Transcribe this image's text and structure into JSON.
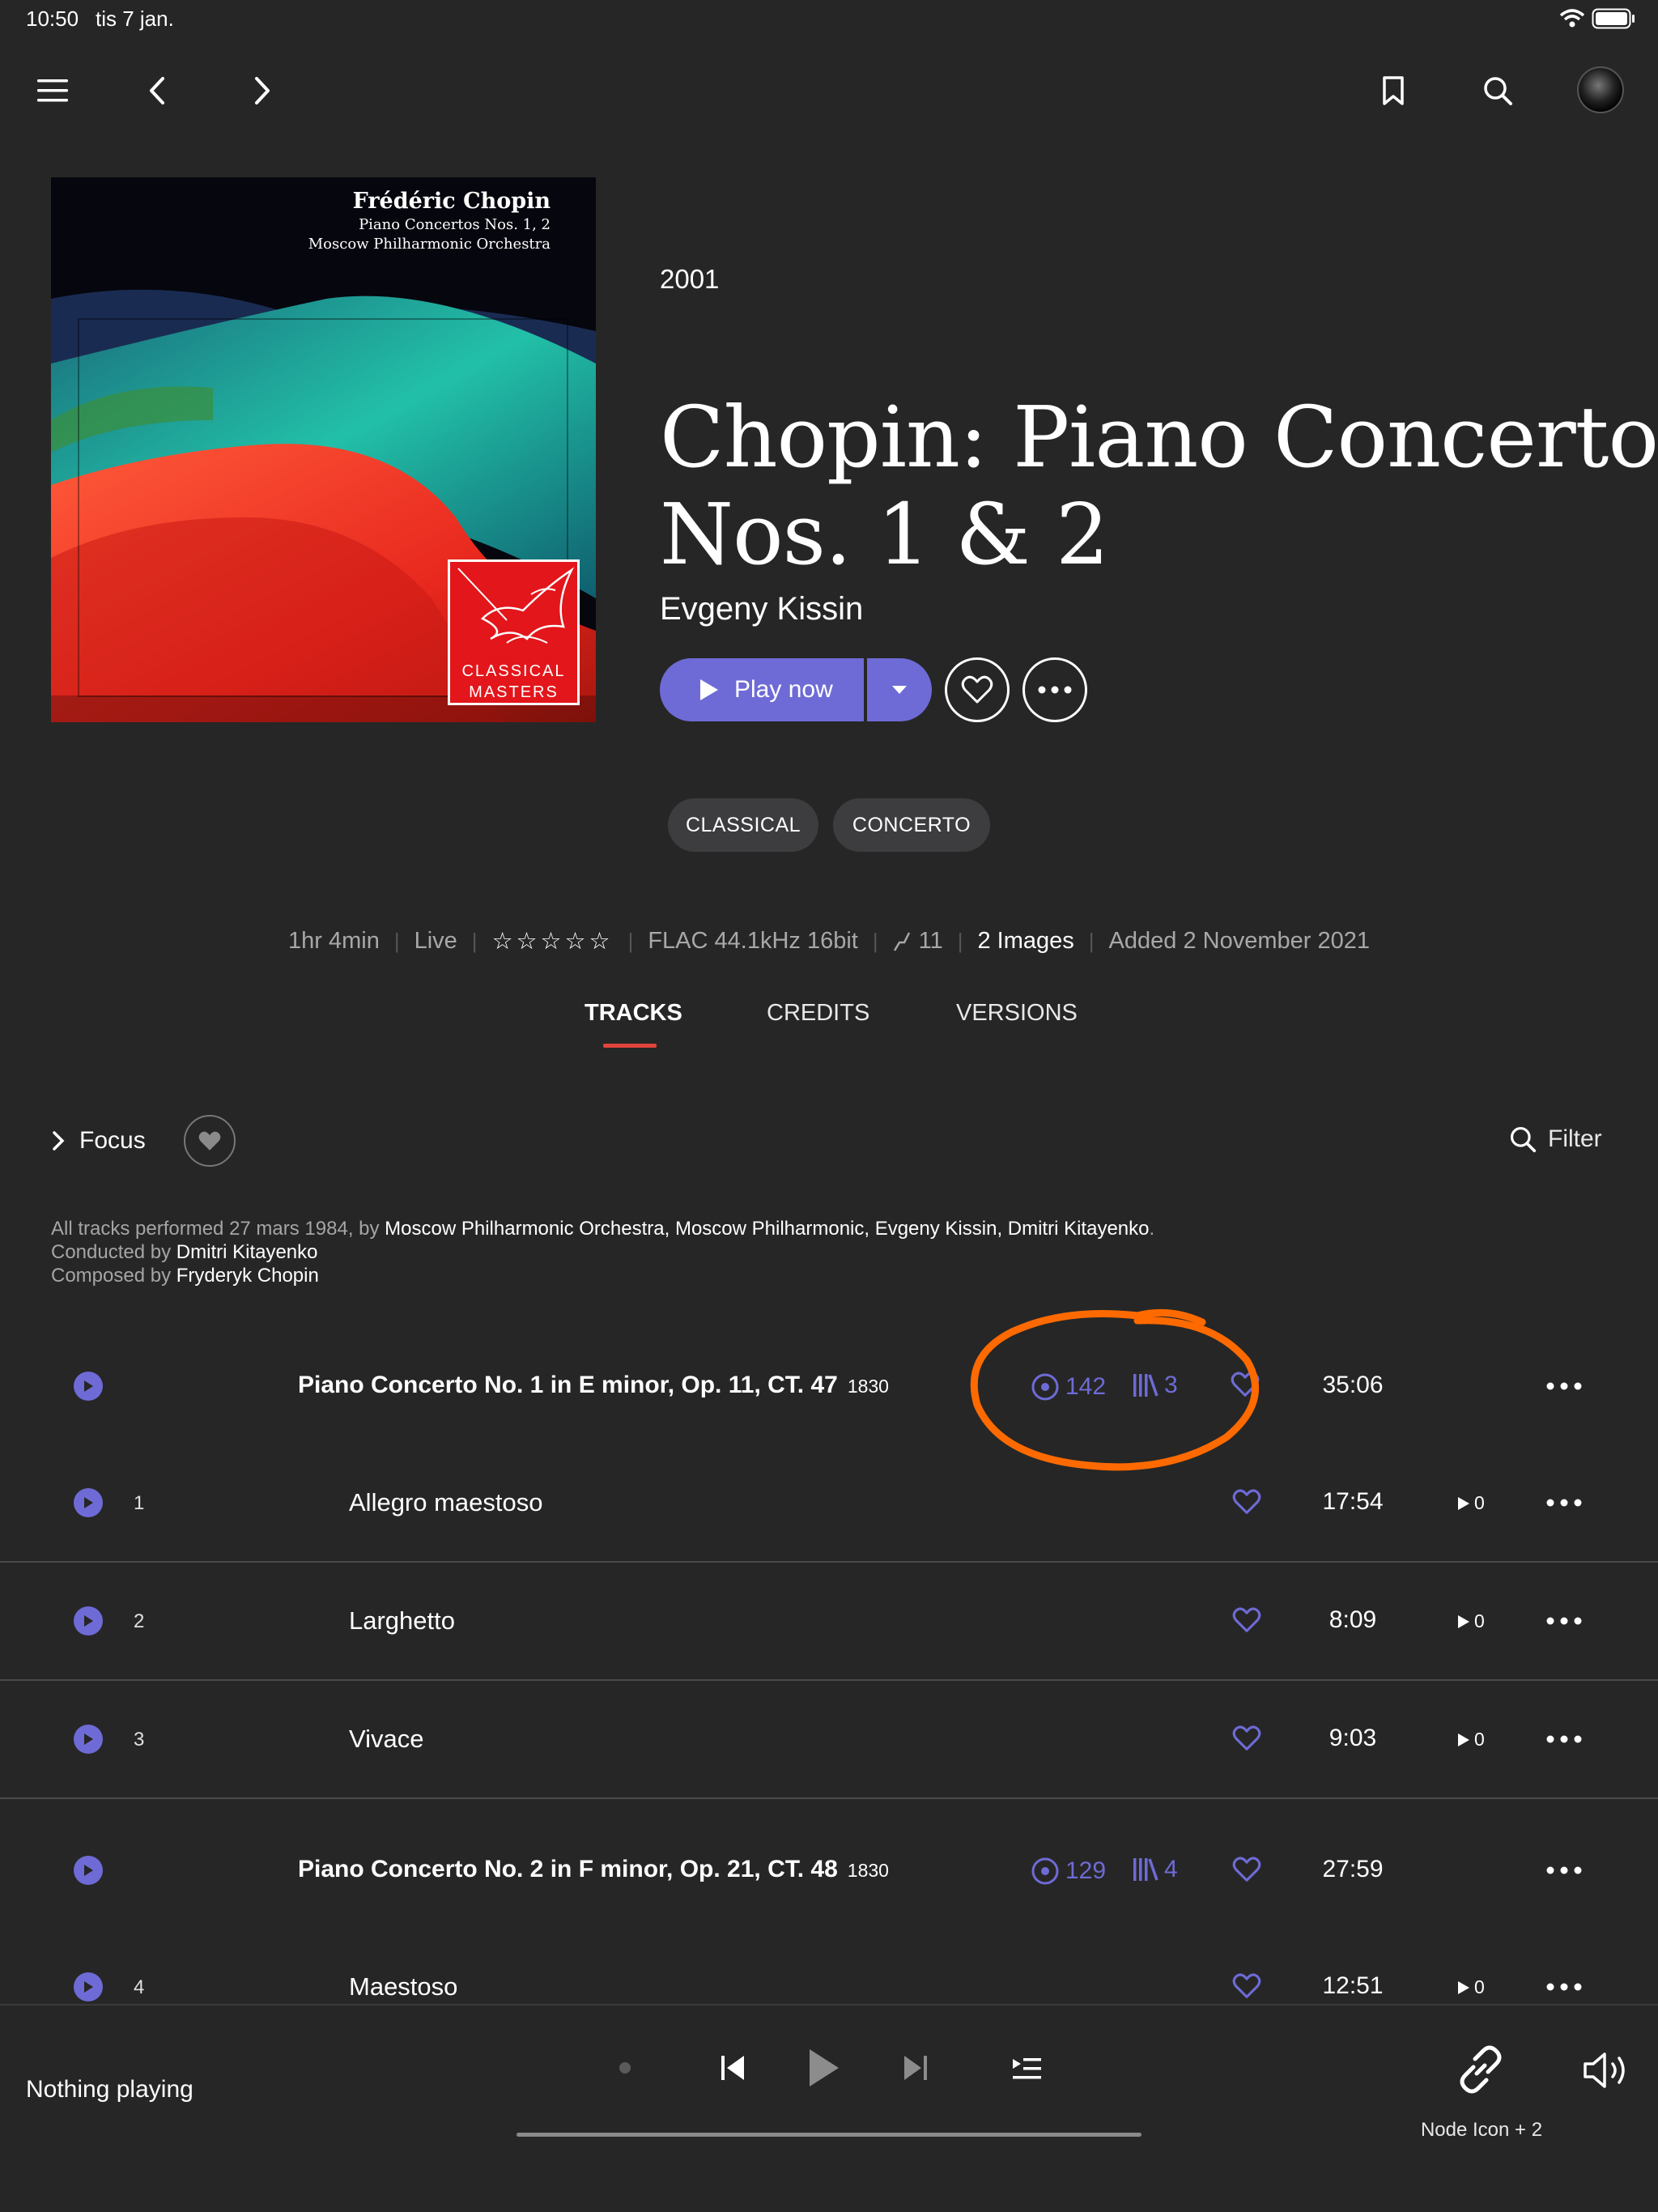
{
  "status_bar": {
    "time": "10:50",
    "date": "tis 7 jan."
  },
  "nav": {
    "icons": [
      "menu-icon",
      "back-icon",
      "forward-icon",
      "bookmark-icon",
      "search-icon",
      "avatar"
    ]
  },
  "album": {
    "cover": {
      "composer": "Frédéric Chopin",
      "work": "Piano Concertos Nos. 1, 2",
      "orchestra": "Moscow Philharmonic Orchestra",
      "label_line1": "CLASSICAL",
      "label_line2": "MASTERS"
    },
    "year": "2001",
    "title_line1": "Chopin: Piano Concertos",
    "title_line2": "Nos. 1 & 2",
    "artist": "Evgeny Kissin",
    "play_label": "Play now",
    "accent_color": "#6e6bd6"
  },
  "genres": [
    "CLASSICAL",
    "CONCERTO"
  ],
  "meta": {
    "duration": "1hr 4min",
    "type": "Live",
    "rating": "☆☆☆☆☆",
    "format": "FLAC 44.1kHz 16bit",
    "tracks_icon_count": "11",
    "images": "2 Images",
    "added": "Added 2 November 2021"
  },
  "tabs": [
    "TRACKS",
    "CREDITS",
    "VERSIONS"
  ],
  "toolbar": {
    "focus": "Focus",
    "filter": "Filter"
  },
  "credits": {
    "performed_prefix": "All tracks performed 27 mars 1984, by ",
    "performers": "Moscow Philharmonic Orchestra, Moscow Philharmonic, Evgeny Kissin, Dmitri Kitayenko",
    "period": ".",
    "conducted_prefix": "Conducted by ",
    "conductor": "Dmitri Kitayenko",
    "composed_prefix": "Composed by ",
    "composer": "Fryderyk Chopin"
  },
  "works": [
    {
      "title": "Piano Concerto No. 1 in E minor, Op. 11, CT. 47",
      "year": "1830",
      "plays": "142",
      "versions": "3",
      "duration": "35:06"
    },
    {
      "title": "Piano Concerto No. 2 in F minor, Op. 21, CT. 48",
      "year": "1830",
      "plays": "129",
      "versions": "4",
      "duration": "27:59"
    }
  ],
  "tracks": [
    {
      "no": "1",
      "title": "Allegro maestoso",
      "duration": "17:54",
      "playcount": "0"
    },
    {
      "no": "2",
      "title": "Larghetto",
      "duration": "8:09",
      "playcount": "0"
    },
    {
      "no": "3",
      "title": "Vivace",
      "duration": "9:03",
      "playcount": "0"
    },
    {
      "no": "4",
      "title": "Maestoso",
      "duration": "12:51",
      "playcount": "0"
    }
  ],
  "player": {
    "status": "Nothing playing",
    "zone": "Node Icon + 2"
  },
  "annotation_color": "#ff6a00"
}
